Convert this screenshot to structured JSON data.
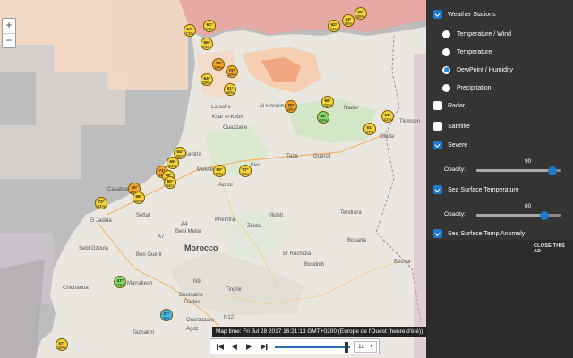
{
  "map": {
    "zoom_in": "+",
    "zoom_out": "−",
    "colors": {
      "land": "#e9e7df",
      "sea": "#bdbdbd",
      "mediterranean": "#e7a9a4",
      "warm": "#f6d3b6",
      "hot": "#f2a680",
      "grass": "#cfe6c4"
    },
    "places": [
      {
        "label": "Morocco",
        "kind": "big"
      },
      {
        "label": "Larache",
        "kind": "small"
      },
      {
        "label": "Ksar el-Kebir",
        "kind": "small"
      },
      {
        "label": "Ouazzane",
        "kind": "small"
      },
      {
        "label": "Al Hoceima",
        "kind": "small"
      },
      {
        "label": "Taza",
        "kind": "small"
      },
      {
        "label": "Guercif",
        "kind": "small"
      },
      {
        "label": "Meknès",
        "kind": "small"
      },
      {
        "label": "Oujda",
        "kind": "small"
      },
      {
        "label": "Tlemcen",
        "kind": "small"
      },
      {
        "label": "Settat",
        "kind": "small"
      },
      {
        "label": "Khenifra",
        "kind": "small"
      },
      {
        "label": "Zeida",
        "kind": "small"
      },
      {
        "label": "Midelt",
        "kind": "small"
      },
      {
        "label": "Tendrara",
        "kind": "small"
      },
      {
        "label": "Bouarfa",
        "kind": "small"
      },
      {
        "label": "Ben Guerir",
        "kind": "small"
      },
      {
        "label": "Sebt Gzoula",
        "kind": "small"
      },
      {
        "label": "Chichaoua",
        "kind": "small"
      },
      {
        "label": "Marrakesh",
        "kind": "small"
      },
      {
        "label": "Boumalne",
        "kind": "small"
      },
      {
        "label": "Dades",
        "kind": "small"
      },
      {
        "label": "Tinghir",
        "kind": "small"
      },
      {
        "label": "Er Rachidia",
        "kind": "small"
      },
      {
        "label": "Boudnib",
        "kind": "small"
      },
      {
        "label": "Ouarzazate",
        "kind": "small"
      },
      {
        "label": "Taznakht",
        "kind": "small"
      },
      {
        "label": "Agdz",
        "kind": "small"
      },
      {
        "label": "Casablanca",
        "kind": "small"
      },
      {
        "label": "El Jadida",
        "kind": "small"
      },
      {
        "label": "Kenitra",
        "kind": "small"
      },
      {
        "label": "Fes",
        "kind": "small"
      },
      {
        "label": "Béchar",
        "kind": "small"
      },
      {
        "label": "Nador",
        "kind": "small"
      },
      {
        "label": "Azrou",
        "kind": "small"
      },
      {
        "label": "Beni Mellal",
        "kind": "small"
      }
    ],
    "road_labels": [
      "A4",
      "N12",
      "N9",
      "A7"
    ],
    "stations": [
      {
        "temp": "65°",
        "hum": "39%",
        "color": "#f3d23a"
      },
      {
        "temp": "62°",
        "hum": "63%",
        "color": "#f3d23a"
      },
      {
        "temp": "64°",
        "hum": "73%",
        "color": "#f3d23a"
      },
      {
        "temp": "62°",
        "hum": "54%",
        "color": "#f3d23a"
      },
      {
        "temp": "63°",
        "hum": "78%",
        "color": "#f3d23a"
      },
      {
        "temp": "65°",
        "hum": "71%",
        "color": "#f3d23a"
      },
      {
        "temp": "73°",
        "hum": "26%",
        "color": "#f3a62a"
      },
      {
        "temp": "72°",
        "hum": "20%",
        "color": "#f3a62a"
      },
      {
        "temp": "64°",
        "hum": "39%",
        "color": "#f3d23a"
      },
      {
        "temp": "61°",
        "hum": "56%",
        "color": "#f3d23a"
      },
      {
        "temp": "70°",
        "hum": "25%",
        "color": "#f3a62a"
      },
      {
        "temp": "66°",
        "hum": "32%",
        "color": "#f3d23a"
      },
      {
        "temp": "46°",
        "hum": "64%",
        "color": "#7fd96a"
      },
      {
        "temp": "61°",
        "hum": "41%",
        "color": "#f3d23a"
      },
      {
        "temp": "51°",
        "hum": "44%",
        "color": "#f3d23a"
      },
      {
        "temp": "64°",
        "hum": "45%",
        "color": "#f3d23a"
      },
      {
        "temp": "66°",
        "hum": "34%",
        "color": "#f3d23a"
      },
      {
        "temp": "71°",
        "hum": "41%",
        "color": "#f3a62a"
      },
      {
        "temp": "68°",
        "hum": "30%",
        "color": "#f3d23a"
      },
      {
        "temp": "60°",
        "hum": "34%",
        "color": "#f3d23a"
      },
      {
        "temp": "60°",
        "hum": "30%",
        "color": "#f3d23a"
      },
      {
        "temp": "57°",
        "hum": "25%",
        "color": "#f3d23a"
      },
      {
        "temp": "70°",
        "hum": "29%",
        "color": "#f3a62a"
      },
      {
        "temp": "72°",
        "hum": "34%",
        "color": "#f3d23a"
      },
      {
        "temp": "58°",
        "hum": "28%",
        "color": "#f3d23a"
      },
      {
        "temp": "47°",
        "hum": "10%",
        "color": "#7fd96a"
      },
      {
        "temp": "27°",
        "hum": "6%",
        "color": "#43b7e8"
      },
      {
        "temp": "57°",
        "hum": "30%",
        "color": "#f3d23a"
      }
    ]
  },
  "timeline": {
    "map_time": "Map time: Fri Jul 28 2017 16:21:13 GMT+0200 (Europe de l'Ouest (heure d'été))",
    "speed": "1x",
    "progress": 0.95
  },
  "layers": {
    "weather_stations": {
      "label": "Weather Stations",
      "checked": true
    },
    "options": [
      {
        "label": "Temperature / Wind",
        "selected": false
      },
      {
        "label": "Temperature",
        "selected": false
      },
      {
        "label": "DewPoint / Humidity",
        "selected": true
      },
      {
        "label": "Precipitation",
        "selected": false
      }
    ],
    "radar": {
      "label": "Radar",
      "checked": false
    },
    "satellite": {
      "label": "Satellite",
      "checked": false
    },
    "severe": {
      "label": "Severe",
      "checked": true,
      "opacity_label": "Opacity:",
      "opacity": "90"
    },
    "sst": {
      "label": "Sea Surface Temperature",
      "checked": true,
      "opacity_label": "Opacity:",
      "opacity": "80"
    },
    "sst_anomaly": {
      "label": "Sea Surface Temp Anomaly",
      "checked": true
    },
    "close_ad": "CLOSE THIS AD"
  }
}
